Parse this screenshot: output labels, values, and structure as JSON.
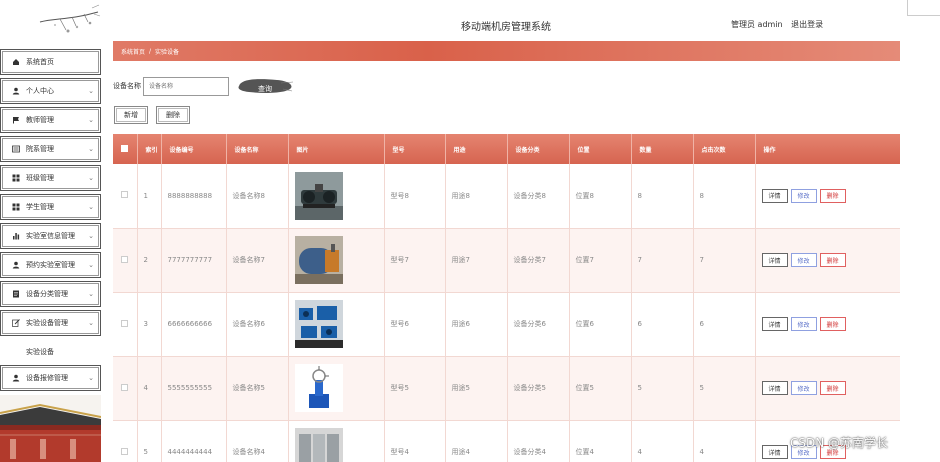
{
  "header": {
    "system_title": "移动端机房管理系统",
    "user_label": "管理员 admin",
    "logout_label": "退出登录"
  },
  "sidebar": {
    "items": [
      {
        "label": "系统首页",
        "icon": "home-icon",
        "chevron": false
      },
      {
        "label": "个人中心",
        "icon": "user-icon",
        "chevron": true
      },
      {
        "label": "教师管理",
        "icon": "flag-icon",
        "chevron": true
      },
      {
        "label": "院系管理",
        "icon": "list-icon",
        "chevron": true
      },
      {
        "label": "班级管理",
        "icon": "grid-icon",
        "chevron": true
      },
      {
        "label": "学生管理",
        "icon": "grid-icon",
        "chevron": true
      },
      {
        "label": "实验室信息管理",
        "icon": "bar-chart-icon",
        "chevron": true
      },
      {
        "label": "预约实验室管理",
        "icon": "user-icon",
        "chevron": true
      },
      {
        "label": "设备分类管理",
        "icon": "doc-icon",
        "chevron": true
      },
      {
        "label": "实验设备管理",
        "icon": "edit-icon",
        "chevron": true
      }
    ],
    "sub_item": "实验设备",
    "last_item": {
      "label": "设备报修管理",
      "icon": "user-icon",
      "chevron": true
    }
  },
  "breadcrumb": {
    "home": "系统首页",
    "separator": "/",
    "current": "实验设备"
  },
  "search": {
    "label": "设备名称",
    "placeholder": "设备名称",
    "button": "查询"
  },
  "actions": {
    "add": "新增",
    "delete": "删除"
  },
  "table": {
    "columns": [
      "",
      "索引",
      "设备编号",
      "设备名称",
      "图片",
      "型号",
      "用途",
      "设备分类",
      "位置",
      "数量",
      "点击次数",
      "操作"
    ],
    "row_buttons": {
      "detail": "详情",
      "edit": "修改",
      "delete": "删除"
    },
    "rows": [
      {
        "index": "1",
        "code": "8888888888",
        "name": "设备名称8",
        "model": "型号8",
        "usage": "用途8",
        "category": "设备分类8",
        "location": "位置8",
        "qty": "8",
        "clicks": "8",
        "img": "lathe"
      },
      {
        "index": "2",
        "code": "7777777777",
        "name": "设备名称7",
        "model": "型号7",
        "usage": "用途7",
        "category": "设备分类7",
        "location": "位置7",
        "qty": "7",
        "clicks": "7",
        "img": "boiler"
      },
      {
        "index": "3",
        "code": "6666666666",
        "name": "设备名称6",
        "model": "型号6",
        "usage": "用途6",
        "category": "设备分类6",
        "location": "位置6",
        "qty": "6",
        "clicks": "6",
        "img": "pumps"
      },
      {
        "index": "4",
        "code": "5555555555",
        "name": "设备名称5",
        "model": "型号5",
        "usage": "用途5",
        "category": "设备分类5",
        "location": "位置5",
        "qty": "5",
        "clicks": "5",
        "img": "coil"
      },
      {
        "index": "5",
        "code": "4444444444",
        "name": "设备名称4",
        "model": "型号4",
        "usage": "用途4",
        "category": "设备分类4",
        "location": "位置4",
        "qty": "4",
        "clicks": "4",
        "img": "tanks"
      }
    ]
  },
  "watermark": "CSDN @苏南学长",
  "colors": {
    "accent": "#d9614a",
    "row_alt": "#fdf3f1"
  }
}
